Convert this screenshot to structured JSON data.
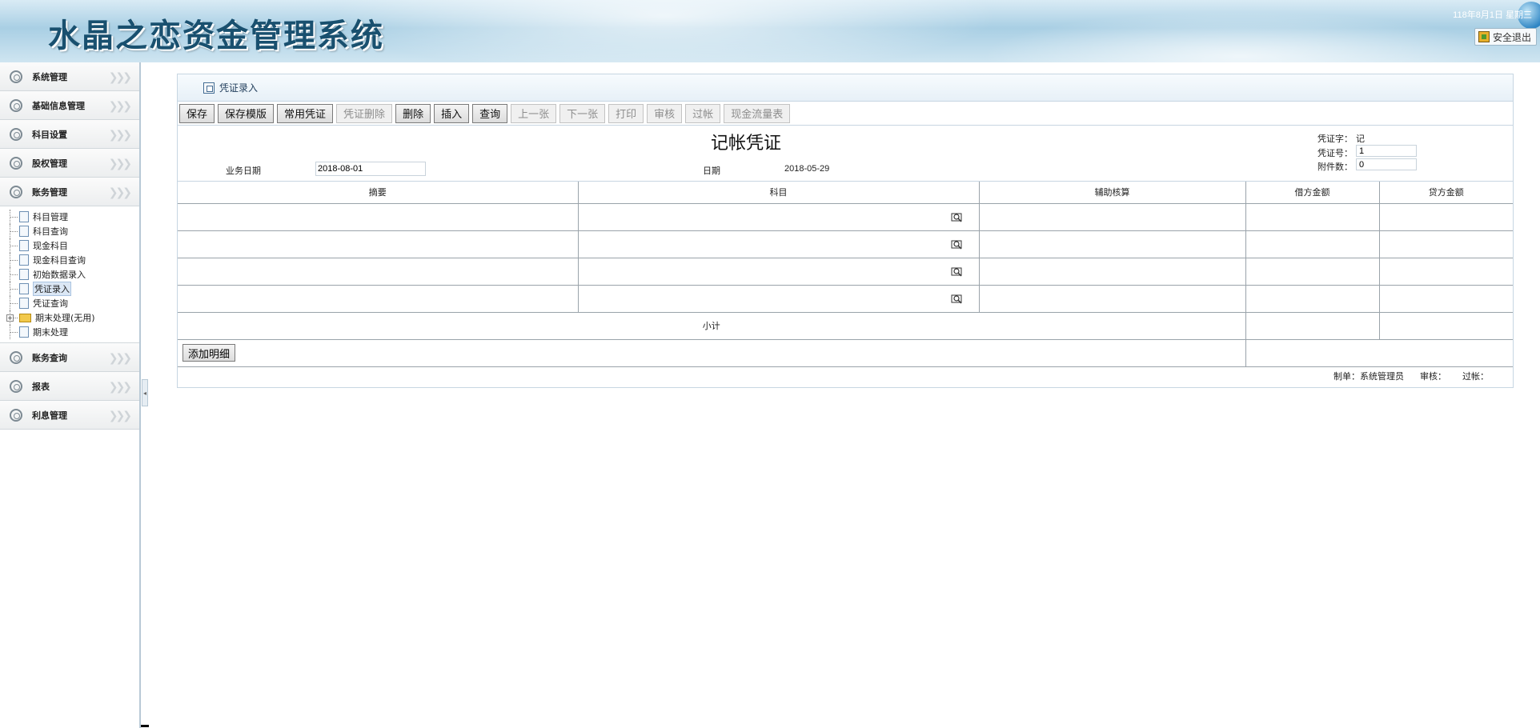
{
  "header": {
    "title": "水晶之恋资金管理系统",
    "date_text": "118年8月1日   星期三",
    "logout_label": "安全退出"
  },
  "sidebar": {
    "groups_top": [
      {
        "label": "系统管理"
      },
      {
        "label": "基础信息管理"
      },
      {
        "label": "科目设置"
      },
      {
        "label": "股权管理"
      },
      {
        "label": "账务管理"
      }
    ],
    "tree": [
      {
        "label": "科目管理",
        "type": "doc"
      },
      {
        "label": "科目查询",
        "type": "doc"
      },
      {
        "label": "现金科目",
        "type": "doc"
      },
      {
        "label": "现金科目查询",
        "type": "doc"
      },
      {
        "label": "初始数据录入",
        "type": "doc"
      },
      {
        "label": "凭证录入",
        "type": "doc",
        "selected": true
      },
      {
        "label": "凭证查询",
        "type": "doc"
      },
      {
        "label": "期末处理(无用)",
        "type": "folder"
      },
      {
        "label": "期末处理",
        "type": "doc"
      }
    ],
    "groups_bottom": [
      {
        "label": "账务查询"
      },
      {
        "label": "报表"
      },
      {
        "label": "利息管理"
      }
    ],
    "arrows": "❯❯❯"
  },
  "panel": {
    "title": "凭证录入",
    "toolbar": [
      {
        "label": "保存",
        "enabled": true
      },
      {
        "label": "保存模版",
        "enabled": true
      },
      {
        "label": "常用凭证",
        "enabled": true
      },
      {
        "label": "凭证删除",
        "enabled": false
      },
      {
        "label": "删除",
        "enabled": true
      },
      {
        "label": "插入",
        "enabled": true
      },
      {
        "label": "查询",
        "enabled": true
      },
      {
        "label": "上一张",
        "enabled": false
      },
      {
        "label": "下一张",
        "enabled": false
      },
      {
        "label": "打印",
        "enabled": false
      },
      {
        "label": "审核",
        "enabled": false
      },
      {
        "label": "过帐",
        "enabled": false
      },
      {
        "label": "现金流量表",
        "enabled": false
      }
    ],
    "voucher": {
      "title": "记帐凭证",
      "business_date_label": "业务日期",
      "business_date_value": "2018-08-01",
      "date_label": "日期",
      "date_value": "2018-05-29",
      "voucher_word_label": "凭证字：",
      "voucher_word_value": "记",
      "voucher_no_label": "凭证号：",
      "voucher_no_value": "1",
      "attachments_label": "附件数：",
      "attachments_value": "0"
    },
    "table": {
      "columns": [
        "摘要",
        "科目",
        "辅助核算",
        "借方金额",
        "贷方金额"
      ],
      "row_count": 4,
      "subtotal_label": "小计",
      "add_button_label": "添加明细"
    },
    "footer": {
      "maker_label": "制单：",
      "maker_value": "系统管理员",
      "reviewer_label": "审核：",
      "poster_label": "过帐："
    }
  }
}
